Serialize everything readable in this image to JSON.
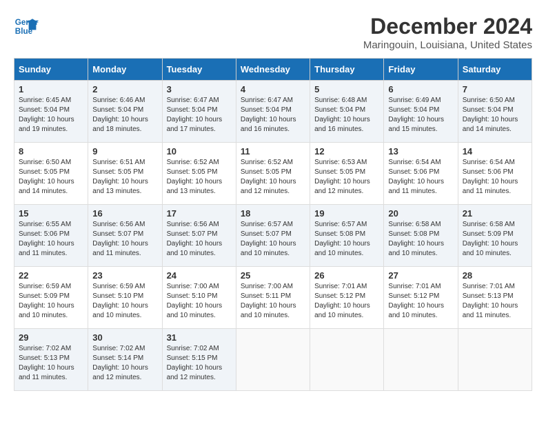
{
  "logo": {
    "line1": "General",
    "line2": "Blue"
  },
  "title": "December 2024",
  "subtitle": "Maringouin, Louisiana, United States",
  "days_of_week": [
    "Sunday",
    "Monday",
    "Tuesday",
    "Wednesday",
    "Thursday",
    "Friday",
    "Saturday"
  ],
  "weeks": [
    [
      {
        "day": "1",
        "sunrise": "6:45 AM",
        "sunset": "5:04 PM",
        "daylight": "10 hours and 19 minutes."
      },
      {
        "day": "2",
        "sunrise": "6:46 AM",
        "sunset": "5:04 PM",
        "daylight": "10 hours and 18 minutes."
      },
      {
        "day": "3",
        "sunrise": "6:47 AM",
        "sunset": "5:04 PM",
        "daylight": "10 hours and 17 minutes."
      },
      {
        "day": "4",
        "sunrise": "6:47 AM",
        "sunset": "5:04 PM",
        "daylight": "10 hours and 16 minutes."
      },
      {
        "day": "5",
        "sunrise": "6:48 AM",
        "sunset": "5:04 PM",
        "daylight": "10 hours and 16 minutes."
      },
      {
        "day": "6",
        "sunrise": "6:49 AM",
        "sunset": "5:04 PM",
        "daylight": "10 hours and 15 minutes."
      },
      {
        "day": "7",
        "sunrise": "6:50 AM",
        "sunset": "5:04 PM",
        "daylight": "10 hours and 14 minutes."
      }
    ],
    [
      {
        "day": "8",
        "sunrise": "6:50 AM",
        "sunset": "5:05 PM",
        "daylight": "10 hours and 14 minutes."
      },
      {
        "day": "9",
        "sunrise": "6:51 AM",
        "sunset": "5:05 PM",
        "daylight": "10 hours and 13 minutes."
      },
      {
        "day": "10",
        "sunrise": "6:52 AM",
        "sunset": "5:05 PM",
        "daylight": "10 hours and 13 minutes."
      },
      {
        "day": "11",
        "sunrise": "6:52 AM",
        "sunset": "5:05 PM",
        "daylight": "10 hours and 12 minutes."
      },
      {
        "day": "12",
        "sunrise": "6:53 AM",
        "sunset": "5:05 PM",
        "daylight": "10 hours and 12 minutes."
      },
      {
        "day": "13",
        "sunrise": "6:54 AM",
        "sunset": "5:06 PM",
        "daylight": "10 hours and 11 minutes."
      },
      {
        "day": "14",
        "sunrise": "6:54 AM",
        "sunset": "5:06 PM",
        "daylight": "10 hours and 11 minutes."
      }
    ],
    [
      {
        "day": "15",
        "sunrise": "6:55 AM",
        "sunset": "5:06 PM",
        "daylight": "10 hours and 11 minutes."
      },
      {
        "day": "16",
        "sunrise": "6:56 AM",
        "sunset": "5:07 PM",
        "daylight": "10 hours and 11 minutes."
      },
      {
        "day": "17",
        "sunrise": "6:56 AM",
        "sunset": "5:07 PM",
        "daylight": "10 hours and 10 minutes."
      },
      {
        "day": "18",
        "sunrise": "6:57 AM",
        "sunset": "5:07 PM",
        "daylight": "10 hours and 10 minutes."
      },
      {
        "day": "19",
        "sunrise": "6:57 AM",
        "sunset": "5:08 PM",
        "daylight": "10 hours and 10 minutes."
      },
      {
        "day": "20",
        "sunrise": "6:58 AM",
        "sunset": "5:08 PM",
        "daylight": "10 hours and 10 minutes."
      },
      {
        "day": "21",
        "sunrise": "6:58 AM",
        "sunset": "5:09 PM",
        "daylight": "10 hours and 10 minutes."
      }
    ],
    [
      {
        "day": "22",
        "sunrise": "6:59 AM",
        "sunset": "5:09 PM",
        "daylight": "10 hours and 10 minutes."
      },
      {
        "day": "23",
        "sunrise": "6:59 AM",
        "sunset": "5:10 PM",
        "daylight": "10 hours and 10 minutes."
      },
      {
        "day": "24",
        "sunrise": "7:00 AM",
        "sunset": "5:10 PM",
        "daylight": "10 hours and 10 minutes."
      },
      {
        "day": "25",
        "sunrise": "7:00 AM",
        "sunset": "5:11 PM",
        "daylight": "10 hours and 10 minutes."
      },
      {
        "day": "26",
        "sunrise": "7:01 AM",
        "sunset": "5:12 PM",
        "daylight": "10 hours and 10 minutes."
      },
      {
        "day": "27",
        "sunrise": "7:01 AM",
        "sunset": "5:12 PM",
        "daylight": "10 hours and 10 minutes."
      },
      {
        "day": "28",
        "sunrise": "7:01 AM",
        "sunset": "5:13 PM",
        "daylight": "10 hours and 11 minutes."
      }
    ],
    [
      {
        "day": "29",
        "sunrise": "7:02 AM",
        "sunset": "5:13 PM",
        "daylight": "10 hours and 11 minutes."
      },
      {
        "day": "30",
        "sunrise": "7:02 AM",
        "sunset": "5:14 PM",
        "daylight": "10 hours and 12 minutes."
      },
      {
        "day": "31",
        "sunrise": "7:02 AM",
        "sunset": "5:15 PM",
        "daylight": "10 hours and 12 minutes."
      },
      null,
      null,
      null,
      null
    ]
  ]
}
